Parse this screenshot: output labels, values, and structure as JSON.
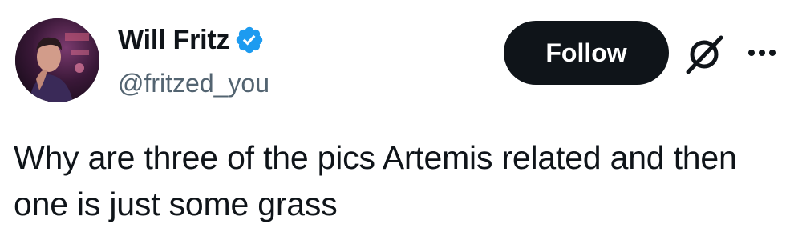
{
  "author": {
    "display_name": "Will Fritz",
    "handle": "@fritzed_you",
    "verified": true,
    "verified_color": "#1d9bf0"
  },
  "actions": {
    "follow_label": "Follow",
    "grok_icon": "grok-icon",
    "more_icon": "more-horizontal-icon"
  },
  "tweet": {
    "text": "Why are three of the pics Artemis related and then one is just some grass"
  },
  "colors": {
    "text": "#0f1419",
    "secondary_text": "#536471",
    "follow_bg": "#0f1419",
    "follow_text": "#ffffff"
  }
}
